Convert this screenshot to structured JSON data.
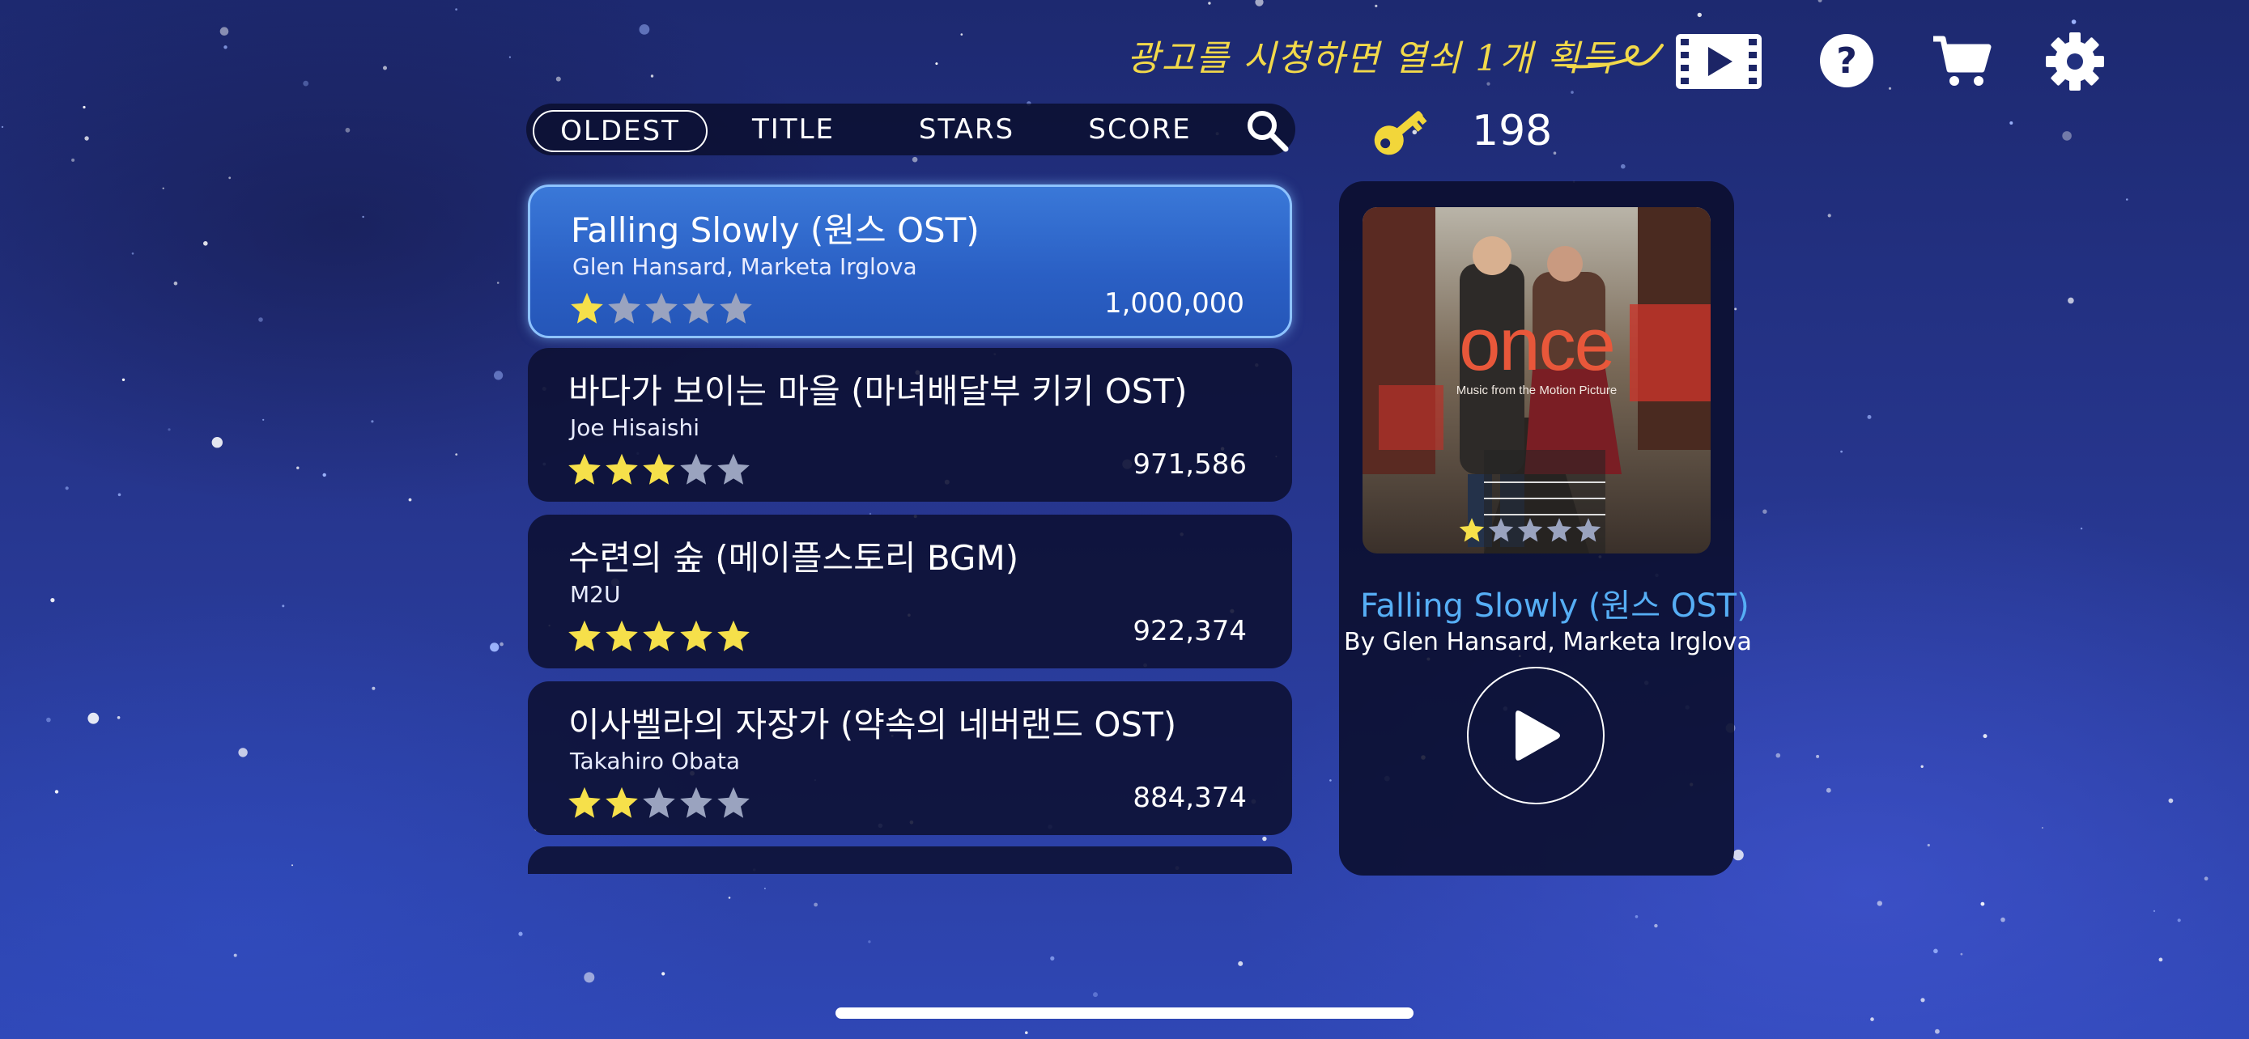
{
  "topbar": {
    "ad_hint": "광고를 시청하면 열쇠 1개 획득",
    "icons": {
      "video": "film-play-icon",
      "help": "help-icon",
      "cart": "cart-icon",
      "settings": "gear-icon"
    },
    "help_glyph": "?"
  },
  "sort": {
    "tabs": [
      {
        "label": "OLDEST",
        "active": true
      },
      {
        "label": "TITLE",
        "active": false
      },
      {
        "label": "STARS",
        "active": false
      },
      {
        "label": "SCORE",
        "active": false
      }
    ],
    "search_icon": "search-icon"
  },
  "keys": {
    "icon": "key-icon",
    "count": "198"
  },
  "songs": [
    {
      "title": "Falling Slowly (원스 OST)",
      "artist": "Glen Hansard, Marketa Irglova",
      "stars": 1,
      "score": "1,000,000",
      "selected": true
    },
    {
      "title": "바다가 보이는 마을 (마녀배달부 키키 OST)",
      "artist": "Joe Hisaishi",
      "stars": 3,
      "score": "971,586",
      "selected": false
    },
    {
      "title": "수련의 숲 (메이플스토리 BGM)",
      "artist": "M2U",
      "stars": 5,
      "score": "922,374",
      "selected": false
    },
    {
      "title": "이사벨라의 자장가 (약속의 네버랜드 OST)",
      "artist": "Takahiro Obata",
      "stars": 2,
      "score": "884,374",
      "selected": false
    }
  ],
  "max_stars": 5,
  "detail": {
    "album_title": "once",
    "album_subtitle": "Music from the Motion Picture",
    "album_stars": 1,
    "title": "Falling Slowly (원스 OST)",
    "artist": "By Glen Hansard, Marketa Irglova",
    "play_icon": "play-icon"
  },
  "colors": {
    "star_on": "#f6e04a",
    "star_off": "#9aa3bf",
    "accent_blue": "#56aef5",
    "ad_hint": "#f2d94a"
  }
}
